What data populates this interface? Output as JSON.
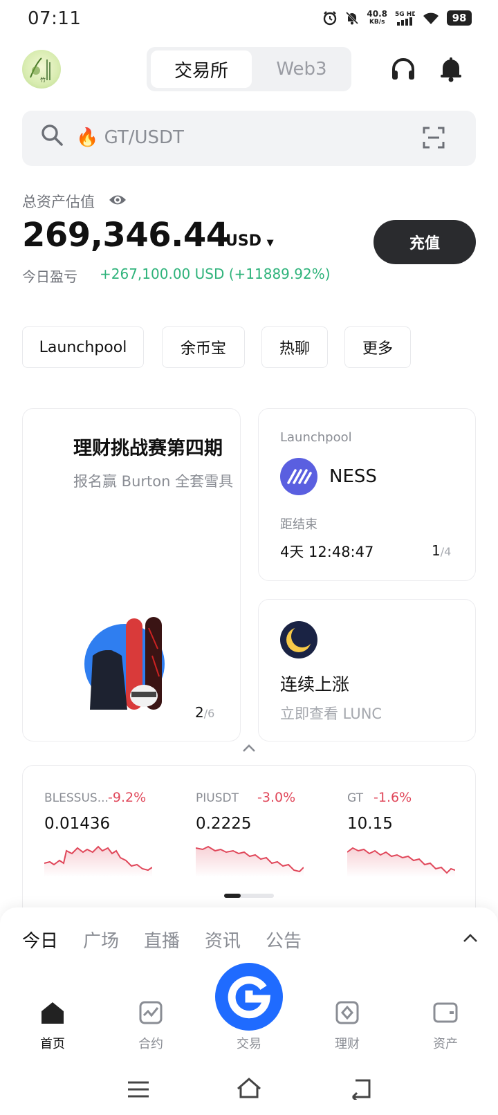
{
  "status_bar": {
    "time": "07:11",
    "speed_value": "40.8",
    "speed_unit": "KB/s",
    "battery": "98",
    "network_icons": [
      "alarm-icon",
      "mute-bell-icon",
      "5g-hd-signal-icon",
      "wifi-icon"
    ]
  },
  "header": {
    "tabs": [
      "交易所",
      "Web3"
    ],
    "active_tab": "交易所",
    "icons": [
      "headset-icon",
      "bell-icon"
    ]
  },
  "search": {
    "placeholder": "🔥 GT/USDT"
  },
  "assets": {
    "label": "总资产估值",
    "value": "269,346.44",
    "currency": "USD",
    "pnl_label": "今日盈亏",
    "pnl_value": "+267,100.00 USD (+11889.92%)",
    "deposit_label": "充值"
  },
  "shortcuts": [
    "Launchpool",
    "余币宝",
    "热聊",
    "更多"
  ],
  "promo_card": {
    "title": "理财挑战赛第四期",
    "subtitle": "报名赢 Burton 全套雪具",
    "page_current": "2",
    "page_total": "/6"
  },
  "launchpool_card": {
    "label": "Launchpool",
    "token": "NESS",
    "ends_label": "距结束",
    "countdown": "4天 12:48:47",
    "page_current": "1",
    "page_total": "/4"
  },
  "lunc_card": {
    "title": "连续上涨",
    "subtitle": "立即查看 LUNC"
  },
  "tickers": [
    {
      "name": "BLESSUS...",
      "change": "-9.2%",
      "price": "0.01436"
    },
    {
      "name": "PIUSDT",
      "change": "-3.0%",
      "price": "0.2225"
    },
    {
      "name": "GT",
      "change": "-1.6%",
      "price": "10.15"
    }
  ],
  "news_tabs": [
    "今日",
    "广场",
    "直播",
    "资讯",
    "公告"
  ],
  "bottom_nav": [
    "首页",
    "合约",
    "交易",
    "理财",
    "资产"
  ],
  "colors": {
    "positive": "#2fb37b",
    "negative": "#e0475a",
    "brand_blue": "#1f6bff",
    "dark_button": "#2a2b2e"
  }
}
